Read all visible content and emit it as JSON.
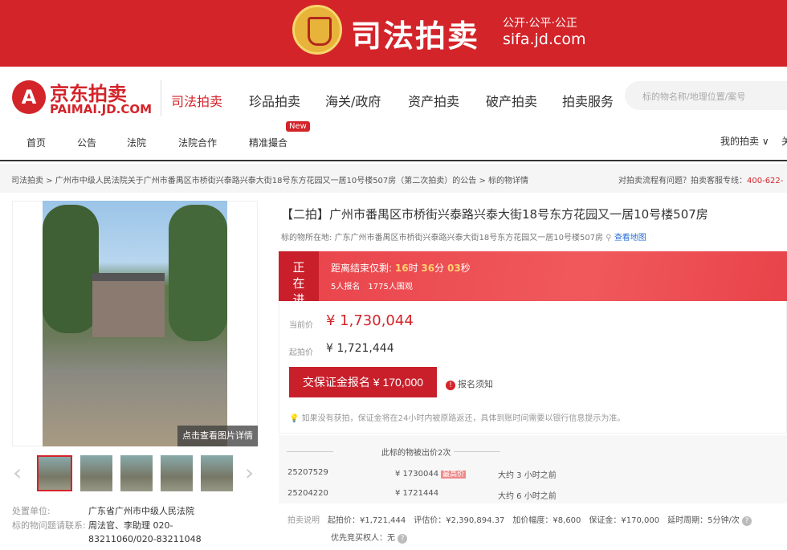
{
  "banner": {
    "title": "司法拍卖",
    "slogan": "公开·公平·公正",
    "url": "sifa.jd.com"
  },
  "header": {
    "logo_cn": "京东拍卖",
    "logo_en": "PAIMAI.JD.COM",
    "nav": [
      "司法拍卖",
      "珍品拍卖",
      "海关/政府",
      "资产拍卖",
      "破产拍卖",
      "拍卖服务"
    ],
    "search_placeholder": "标的物名称/地理位置/案号",
    "subnav": [
      "首页",
      "公告",
      "法院",
      "法院合作",
      "精准撮合"
    ],
    "new_badge": "New",
    "my_auction": "我的拍卖 ∨",
    "cut": "关"
  },
  "breadcrumb": {
    "items": [
      "司法拍卖",
      "广州市中级人民法院关于广州市番禺区市桥街兴泰路兴泰大街18号东方花园又一居10号楼507房（第二次拍卖）的公告",
      "标的物详情"
    ],
    "hotline_label": "对拍卖流程有问题？拍卖客服专线：",
    "hotline": "400-622-"
  },
  "gallery": {
    "caption": "点击查看图片详情"
  },
  "info": {
    "unit_label": "处置单位:",
    "unit": "广东省广州市中级人民法院",
    "contact_label": "标的物问题请联系:",
    "contact": "周法官、李助理 020-83211060/020-83211048"
  },
  "item": {
    "title": "【二拍】广州市番禺区市桥街兴泰路兴泰大街18号东方花园又一居10号楼507房",
    "loc_label": "标的物所在地:",
    "loc": "广东广州市番禺区市桥街兴泰路兴泰大街18号东方花园又一居10号楼507房",
    "map": "查看地图"
  },
  "status": {
    "tag": "正在进行",
    "cd_label": "距离结束仅剩:",
    "h": "16",
    "hu": "时",
    "m": "36",
    "mu": "分",
    "s": "03",
    "su": "秒",
    "signups": "5人报名",
    "watchers": "1775人围观"
  },
  "price": {
    "current_label": "当前价",
    "current": "¥ 1,730,044",
    "start_label": "起拍价",
    "start": "¥ 1,721,444",
    "deposit_btn": "交保证金报名 ¥ 170,000",
    "notice": "报名须知",
    "tip": "如果没有获拍，保证金将在24小时内被原路返还，具体到账时间需要以银行信息提示为准。"
  },
  "bids": {
    "title": "此标的物被出价2次",
    "rows": [
      {
        "id": "25207529",
        "price": "¥ 1730044",
        "badge": "最高价",
        "time": "大约 3 小时之前"
      },
      {
        "id": "25204220",
        "price": "¥ 1721444",
        "time": "大约 6 小时之前"
      }
    ]
  },
  "desc": {
    "label": "拍卖说明",
    "line1": "起拍价：¥1,721,444　评估价：¥2,390,894.37　加价幅度：¥8,600　保证金：¥170,000　延时周期：5分钟/次",
    "line2": "优先竞买权人：无"
  }
}
